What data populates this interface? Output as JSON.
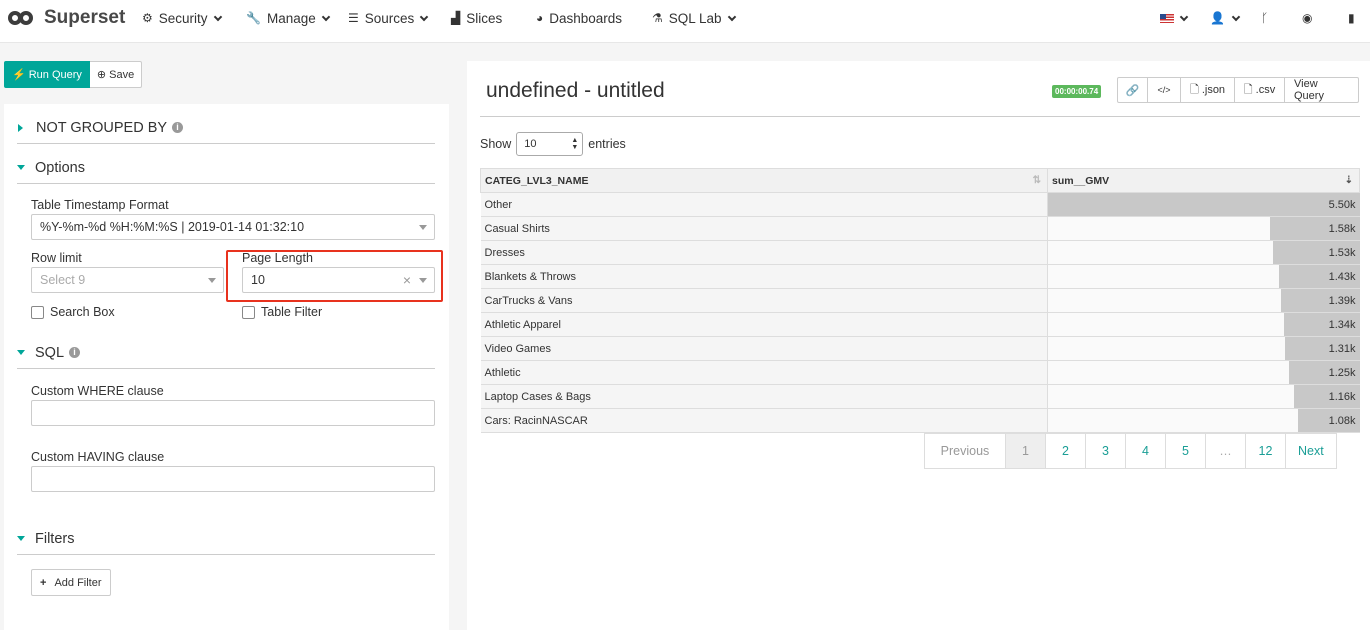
{
  "nav": {
    "brand": "Superset",
    "items": [
      {
        "label": "Security",
        "icon": "cogs-icon",
        "caret": true
      },
      {
        "label": "Manage",
        "icon": "wrench-icon",
        "caret": true
      },
      {
        "label": "Sources",
        "icon": "database-icon",
        "caret": true
      },
      {
        "label": "Slices",
        "icon": "bar-chart-icon",
        "caret": false
      },
      {
        "label": "Dashboards",
        "icon": "dashboard-icon",
        "caret": false
      },
      {
        "label": "SQL Lab",
        "icon": "flask-icon",
        "caret": true
      }
    ]
  },
  "actions": {
    "run": "Run Query",
    "save": "Save"
  },
  "sections": {
    "not_grouped": "NOT GROUPED BY",
    "options": "Options",
    "sql": "SQL",
    "filters": "Filters"
  },
  "options": {
    "ts_format_label": "Table Timestamp Format",
    "ts_format_value": "%Y-%m-%d %H:%M:%S | 2019-01-14 01:32:10",
    "row_limit_label": "Row limit",
    "row_limit_placeholder": "Select 9",
    "page_length_label": "Page Length",
    "page_length_value": "10",
    "search_box_label": "Search Box",
    "table_filter_label": "Table Filter"
  },
  "sql": {
    "where_label": "Custom WHERE clause",
    "having_label": "Custom HAVING clause"
  },
  "filters": {
    "add_label": "Add Filter"
  },
  "result": {
    "title": "undefined - untitled",
    "timer": "00:00:00.74",
    "buttons": {
      "json": ".json",
      "csv": ".csv",
      "view_query": "View Query"
    },
    "show_label": "Show",
    "show_value": "10",
    "entries_label": "entries",
    "columns": [
      "CATEG_LVL3_NAME",
      "sum__GMV"
    ],
    "pagination": [
      "Previous",
      "1",
      "2",
      "3",
      "4",
      "5",
      "…",
      "12",
      "Next"
    ]
  },
  "chart_data": {
    "type": "table",
    "columns": [
      "CATEG_LVL3_NAME",
      "sum__GMV"
    ],
    "rows": [
      {
        "name": "Other",
        "value": 5500,
        "label": "5.50k"
      },
      {
        "name": "Casual Shirts",
        "value": 1580,
        "label": "1.58k"
      },
      {
        "name": "Dresses",
        "value": 1530,
        "label": "1.53k"
      },
      {
        "name": "Blankets & Throws",
        "value": 1430,
        "label": "1.43k"
      },
      {
        "name": "CarTrucks & Vans",
        "value": 1390,
        "label": "1.39k"
      },
      {
        "name": "Athletic Apparel",
        "value": 1340,
        "label": "1.34k"
      },
      {
        "name": "Video Games",
        "value": 1310,
        "label": "1.31k"
      },
      {
        "name": "Athletic",
        "value": 1250,
        "label": "1.25k"
      },
      {
        "name": "Laptop Cases & Bags",
        "value": 1160,
        "label": "1.16k"
      },
      {
        "name": "Cars: RacinNASCAR",
        "value": 1080,
        "label": "1.08k"
      }
    ]
  },
  "colors": {
    "accent": "#00a699",
    "highlight": "#e8321e",
    "timer": "#5cb85c"
  }
}
